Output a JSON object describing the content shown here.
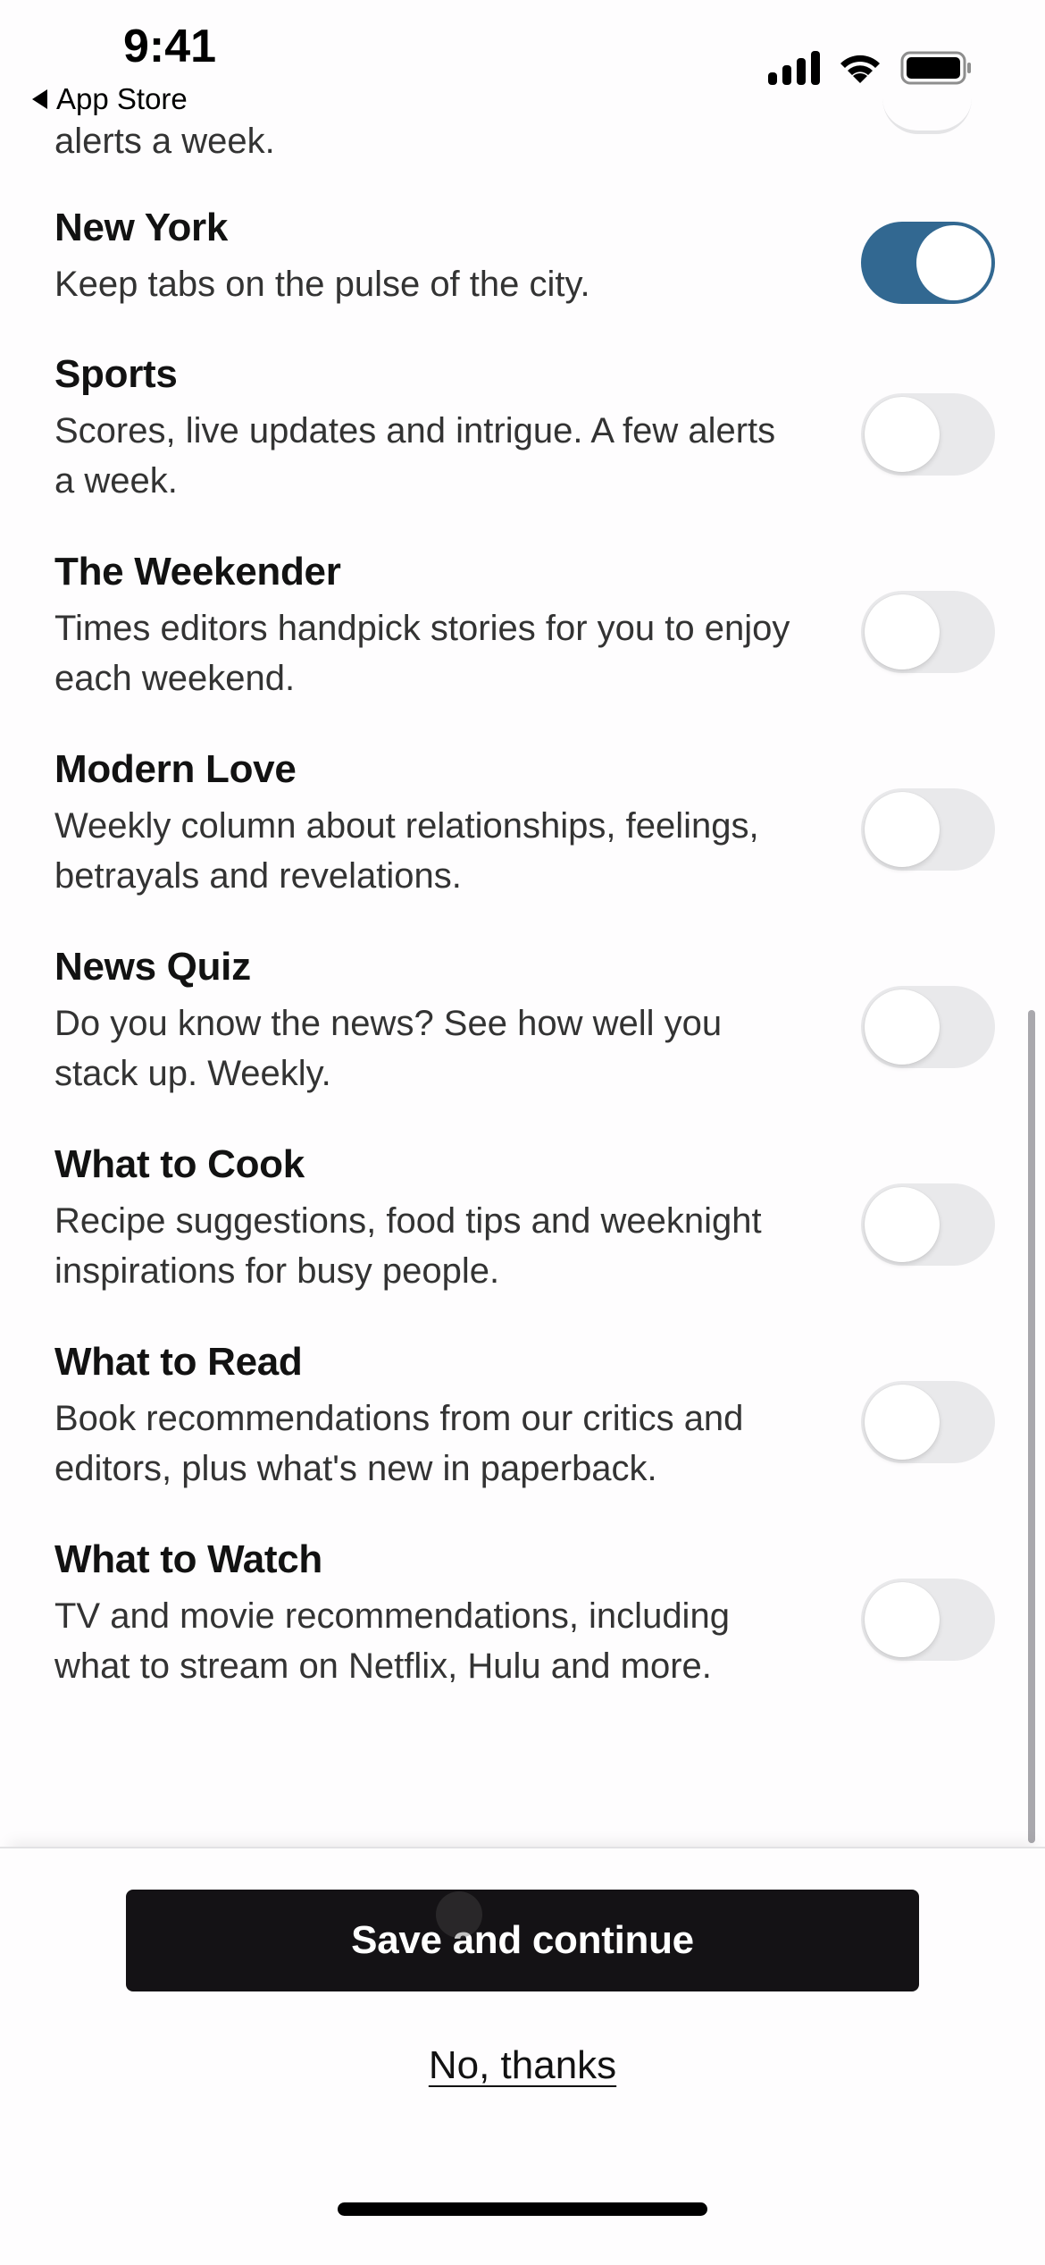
{
  "status_bar": {
    "time": "9:41",
    "back_label": "App Store",
    "icons": [
      "signal-icon",
      "wifi-icon",
      "battery-icon"
    ]
  },
  "partial_item": {
    "description_tail": "alerts a week.",
    "enabled": false
  },
  "colors": {
    "toggle_on": "#326891",
    "toggle_off": "#e9e9eb",
    "primary_button": "#141215"
  },
  "items": [
    {
      "title": "New York",
      "description": "Keep tabs on the pulse of the city.",
      "enabled": true
    },
    {
      "title": "Sports",
      "description": "Scores, live updates and intrigue. A few alerts a week.",
      "enabled": false
    },
    {
      "title": "The Weekender",
      "description": "Times editors handpick stories for you to enjoy each weekend.",
      "enabled": false
    },
    {
      "title": "Modern Love",
      "description": "Weekly column about relationships, feelings, betrayals and revelations.",
      "enabled": false
    },
    {
      "title": "News Quiz",
      "description": "Do you know the news? See how well you stack up. Weekly.",
      "enabled": false
    },
    {
      "title": "What to Cook",
      "description": "Recipe suggestions, food tips and weeknight inspirations for busy people.",
      "enabled": false
    },
    {
      "title": "What to Read",
      "description": "Book recommendations from our critics and editors, plus what's new in paperback.",
      "enabled": false
    },
    {
      "title": "What to Watch",
      "description": "TV and movie recommendations, including what to stream on Netflix, Hulu and more.",
      "enabled": false
    }
  ],
  "footer": {
    "primary_label": "Save and continue",
    "secondary_label": "No, thanks"
  }
}
